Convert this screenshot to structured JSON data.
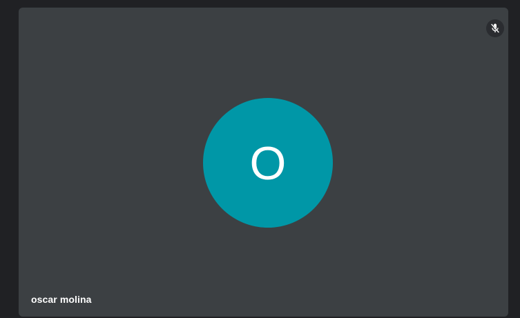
{
  "participant": {
    "name": "oscar molina",
    "avatar_initial": "O",
    "avatar_color": "#0097a7",
    "mic_status": "muted",
    "mic_icon": "mic-off-icon"
  },
  "tile": {
    "background": "#3c4043"
  }
}
